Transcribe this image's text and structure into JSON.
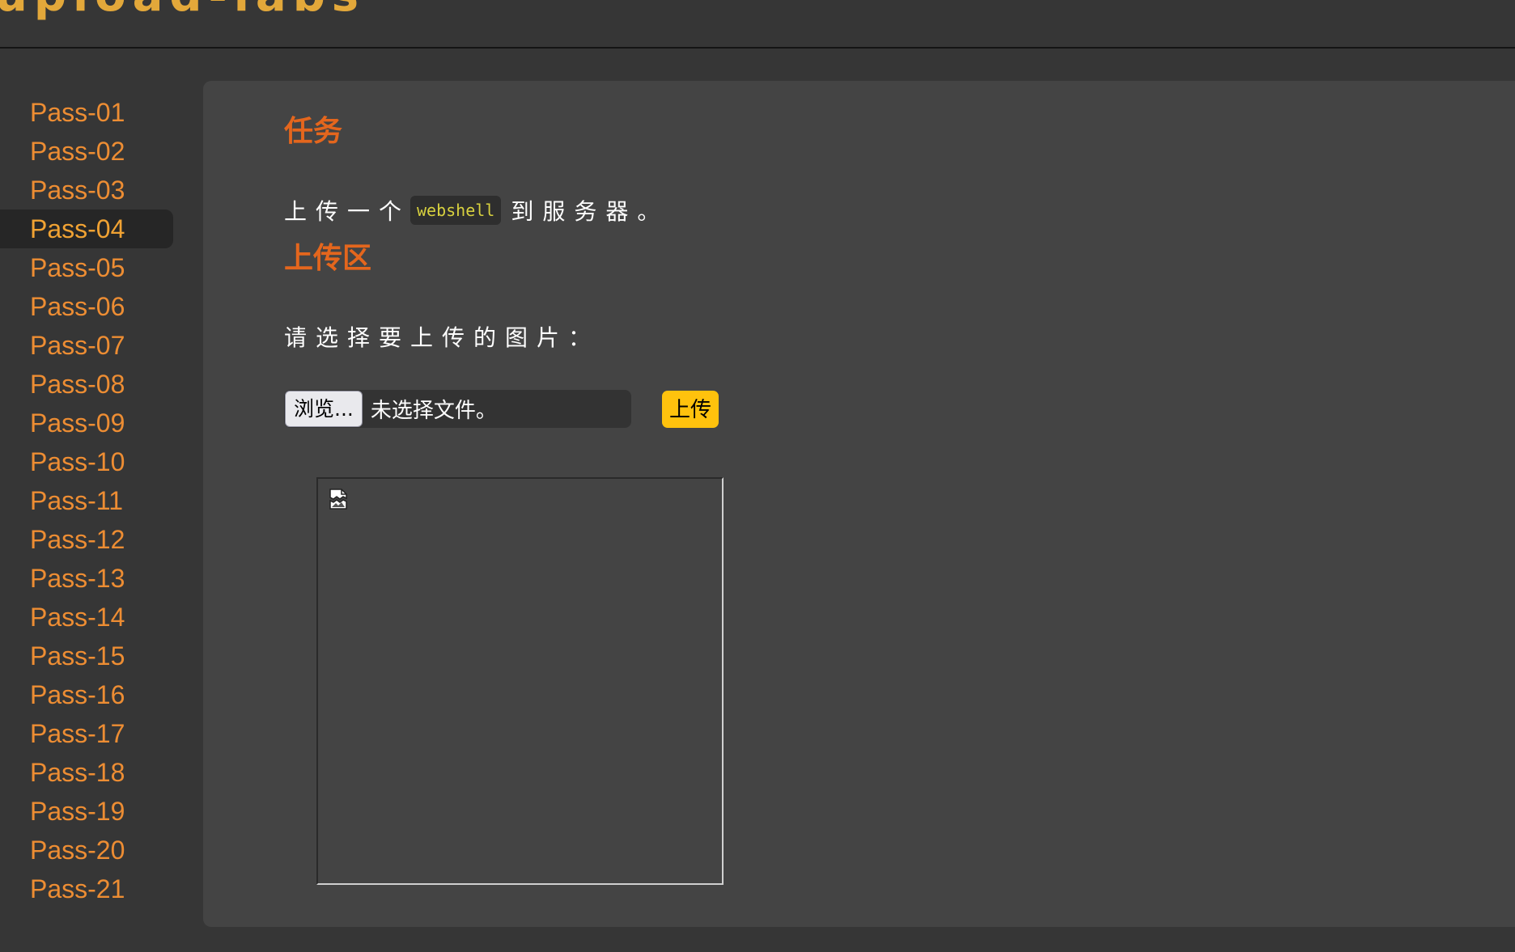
{
  "header": {
    "site_title": "upload-labs"
  },
  "sidebar": {
    "active_index": 3,
    "items": [
      {
        "label": "Pass-01"
      },
      {
        "label": "Pass-02"
      },
      {
        "label": "Pass-03"
      },
      {
        "label": "Pass-04"
      },
      {
        "label": "Pass-05"
      },
      {
        "label": "Pass-06"
      },
      {
        "label": "Pass-07"
      },
      {
        "label": "Pass-08"
      },
      {
        "label": "Pass-09"
      },
      {
        "label": "Pass-10"
      },
      {
        "label": "Pass-11"
      },
      {
        "label": "Pass-12"
      },
      {
        "label": "Pass-13"
      },
      {
        "label": "Pass-14"
      },
      {
        "label": "Pass-15"
      },
      {
        "label": "Pass-16"
      },
      {
        "label": "Pass-17"
      },
      {
        "label": "Pass-18"
      },
      {
        "label": "Pass-19"
      },
      {
        "label": "Pass-20"
      },
      {
        "label": "Pass-21"
      }
    ]
  },
  "main": {
    "task_heading": "任务",
    "task_prefix": "上传一个",
    "task_code": "webshell",
    "task_suffix": "到服务器。",
    "upload_heading": "上传区",
    "select_label": "请选择要上传的图片：",
    "browse_button": "浏览...",
    "no_file_text": "未选择文件。",
    "upload_button": "上传",
    "preview_icon": "broken-image-icon"
  },
  "colors": {
    "background": "#363636",
    "panel": "#444444",
    "nav_link": "#ed8d33",
    "heading": "#e4661d",
    "upload_button": "#ffc20d",
    "code": "#d8d13f"
  }
}
